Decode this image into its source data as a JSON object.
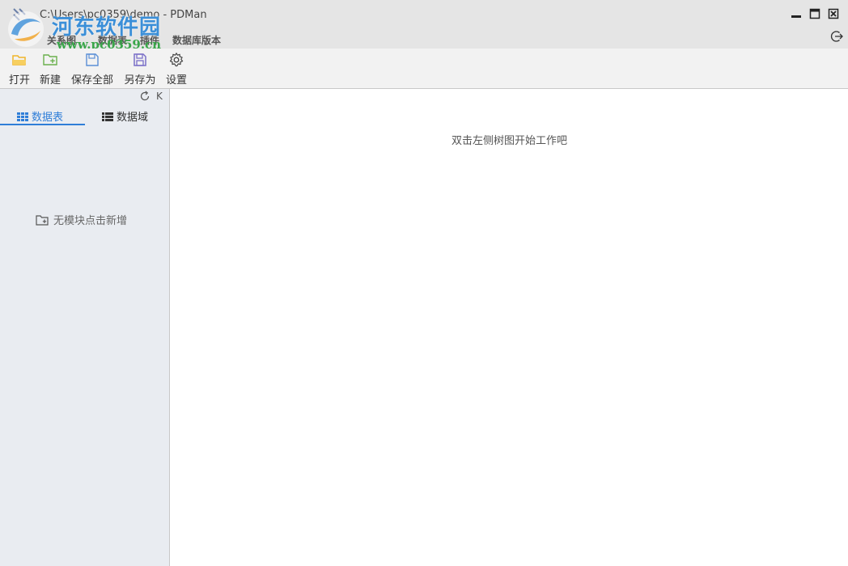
{
  "window": {
    "title": "C:\\Users\\pc0359\\demo - PDMan"
  },
  "watermark": {
    "site_name": "河东软件园",
    "site_url": "www.pc0359.cn"
  },
  "menu": {
    "items": [
      {
        "label": "关系图"
      },
      {
        "label": "数据表"
      },
      {
        "label": "插件"
      },
      {
        "label": "数据库版本"
      }
    ]
  },
  "toolbar": {
    "open_label": "打开",
    "new_label": "新建",
    "save_all_label": "保存全部",
    "save_as_label": "另存为",
    "settings_label": "设置"
  },
  "sidebar": {
    "collapse_label": "K",
    "tabs": [
      {
        "label": "数据表",
        "active": true
      },
      {
        "label": "数据域",
        "active": false
      }
    ],
    "empty_text": "无模块点击新增"
  },
  "main": {
    "hint": "双击左侧树图开始工作吧"
  },
  "colors": {
    "accent": "#2f7ed8",
    "titlebar_bg": "#e5e5e5",
    "sidebar_bg": "#e9ecf1",
    "open_icon": "#f0b429",
    "new_icon": "#6ab04c",
    "save_icon": "#5b8fd6",
    "save_as_icon": "#7b6fc8"
  }
}
